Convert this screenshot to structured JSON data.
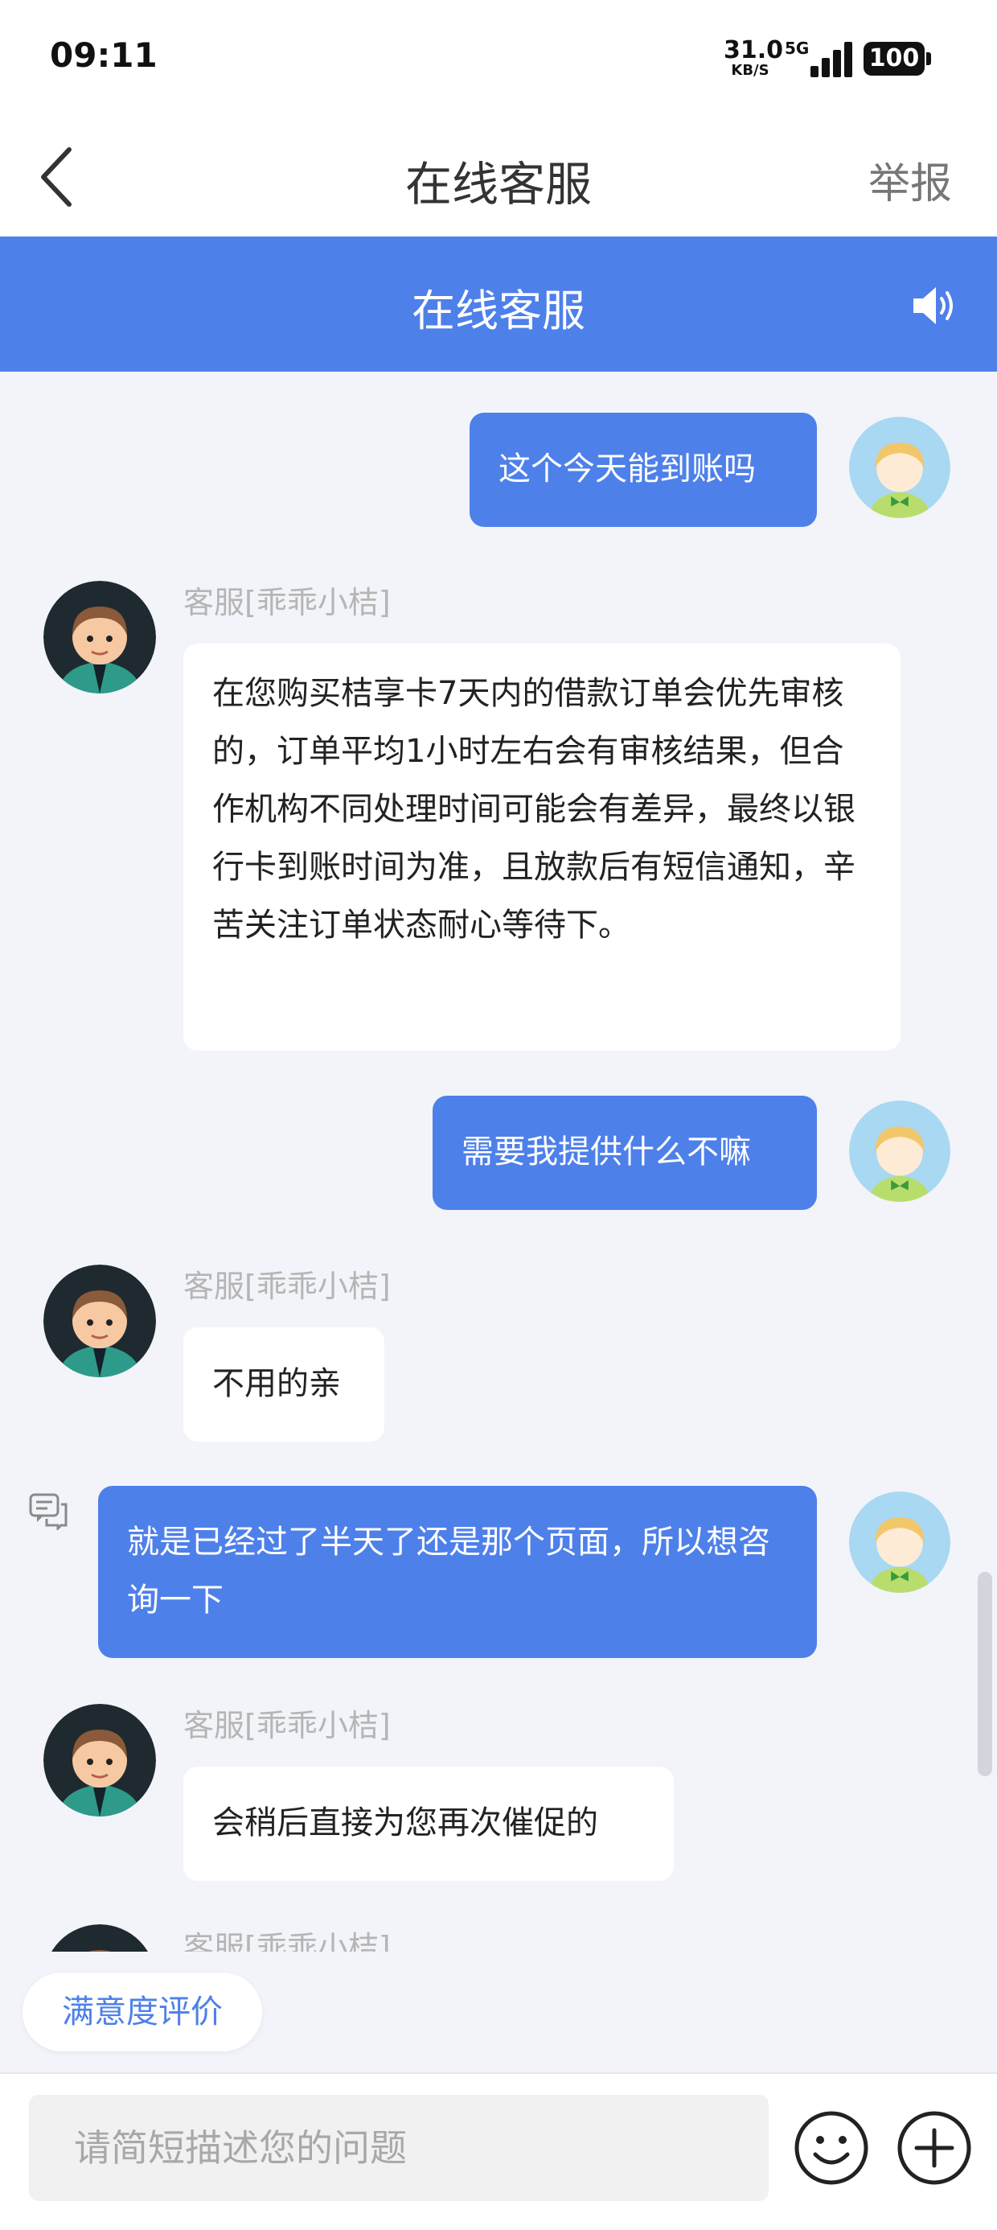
{
  "status_bar": {
    "time": "09:11",
    "net_speed": "31.0",
    "net_speed_unit": "KB/S",
    "network": "5G",
    "battery": "100"
  },
  "nav": {
    "title": "在线客服",
    "report_label": "举报"
  },
  "service_header": {
    "title": "在线客服"
  },
  "messages": [
    {
      "from": "user",
      "text": "这个今天能到账吗"
    },
    {
      "from": "agent",
      "name": "客服[乖乖小桔]",
      "text": "在您购买桔享卡7天内的借款订单会优先审核的，订单平均1小时左右会有审核结果，但合作机构不同处理时间可能会有差异，最终以银行卡到账时间为准，且放款后有短信通知，辛苦关注订单状态耐心等待下。"
    },
    {
      "from": "user",
      "text": "需要我提供什么不嘛"
    },
    {
      "from": "agent",
      "name": "客服[乖乖小桔]",
      "text": "不用的亲"
    },
    {
      "from": "user",
      "text": "就是已经过了半天了还是那个页面，所以想咨询一下"
    },
    {
      "from": "agent",
      "name": "客服[乖乖小桔]",
      "text": "会稍后直接为您再次催促的"
    },
    {
      "from": "agent",
      "name": "客服[乖乖小桔]",
      "text": ""
    }
  ],
  "rating_button": "满意度评价",
  "input": {
    "placeholder": "请简短描述您的问题",
    "value": ""
  },
  "icons": {
    "back": "chevron-left-icon",
    "speaker": "speaker-icon",
    "message_tag": "message-icon",
    "emoji": "emoji-icon",
    "plus": "plus-icon"
  },
  "colors": {
    "accent": "#4e80ea",
    "user_bubble": "#4e80ea",
    "agent_bubble": "#ffffff",
    "chat_background": "#f2f4f9",
    "agent_name": "#b5b5b5"
  }
}
